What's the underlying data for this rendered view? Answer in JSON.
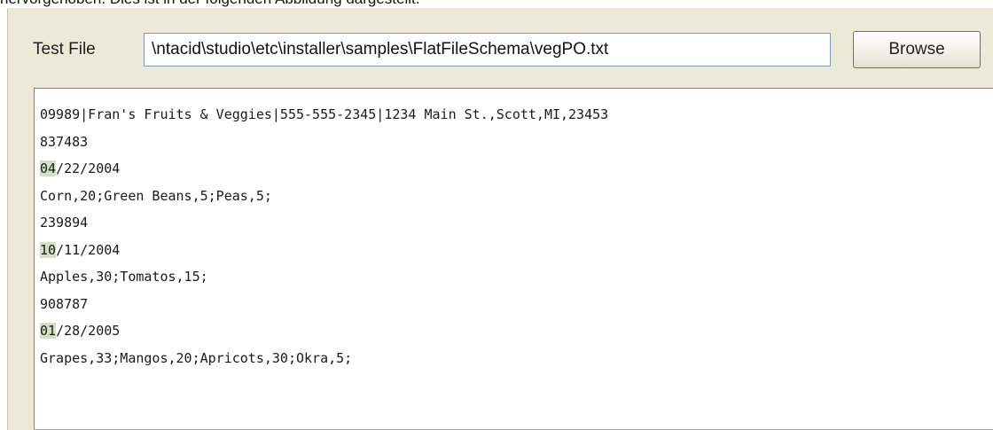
{
  "caption": "hervorgehoben. Dies ist in der folgenden Abbildung dargestellt.",
  "form": {
    "test_file_label": "Test File",
    "test_file_value": "\\ntacid\\studio\\etc\\installer\\samples\\FlatFileSchema\\vegPO.txt",
    "browse_label": "Browse"
  },
  "content": {
    "lines": [
      {
        "hl": "",
        "text": "09989|Fran's Fruits & Veggies|555-555-2345|1234 Main St.,Scott,MI,23453"
      },
      {
        "hl": "",
        "text": "837483"
      },
      {
        "hl": "04",
        "text": "/22/2004"
      },
      {
        "hl": "",
        "text": "Corn,20;Green Beans,5;Peas,5;"
      },
      {
        "hl": "",
        "text": "239894"
      },
      {
        "hl": "10",
        "text": "/11/2004"
      },
      {
        "hl": "",
        "text": "Apples,30;Tomatos,15;"
      },
      {
        "hl": "",
        "text": "908787"
      },
      {
        "hl": "01",
        "text": "/28/2005"
      },
      {
        "hl": "",
        "text": "Grapes,33;Mangos,20;Apricots,30;Okra,5;"
      }
    ]
  },
  "colors": {
    "panel_bg": "#ece9d8",
    "highlight": "#d4e0c4",
    "input_border": "#7f9db9"
  }
}
